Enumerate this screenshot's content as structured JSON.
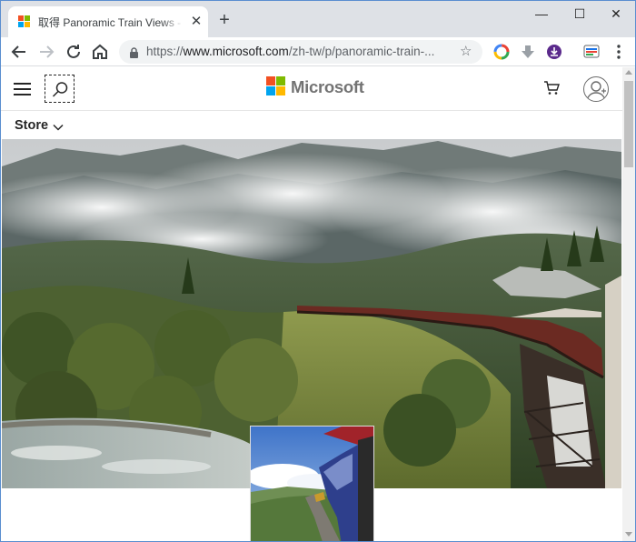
{
  "browser": {
    "tab_title": "取得 Panoramic Train Views - M",
    "tab_close_icon": "close-icon",
    "new_tab_symbol": "+",
    "url_prefix": "https://",
    "url_host": "www.microsoft.com",
    "url_path": "/zh-tw/p/panoramic-train-...",
    "window_min": "—",
    "window_max": "☐",
    "window_close": "✕"
  },
  "site": {
    "brand": "Microsoft",
    "brand_colors": [
      "#f25022",
      "#7fba00",
      "#00a4ef",
      "#ffb900"
    ],
    "nav_menu": "Store"
  },
  "icons": {
    "back": "arrow-left-icon",
    "forward": "arrow-right-icon",
    "reload": "reload-icon",
    "home": "home-icon",
    "lock": "lock-icon",
    "bookmark": "star-icon",
    "search": "search-icon",
    "cart": "cart-icon",
    "account": "avatar-icon",
    "menu": "hamburger-icon"
  },
  "content": {
    "hero_image": "panoramic train on trestle through misty mountain forest",
    "screenshot_image": "view from train window of curving carriages"
  }
}
